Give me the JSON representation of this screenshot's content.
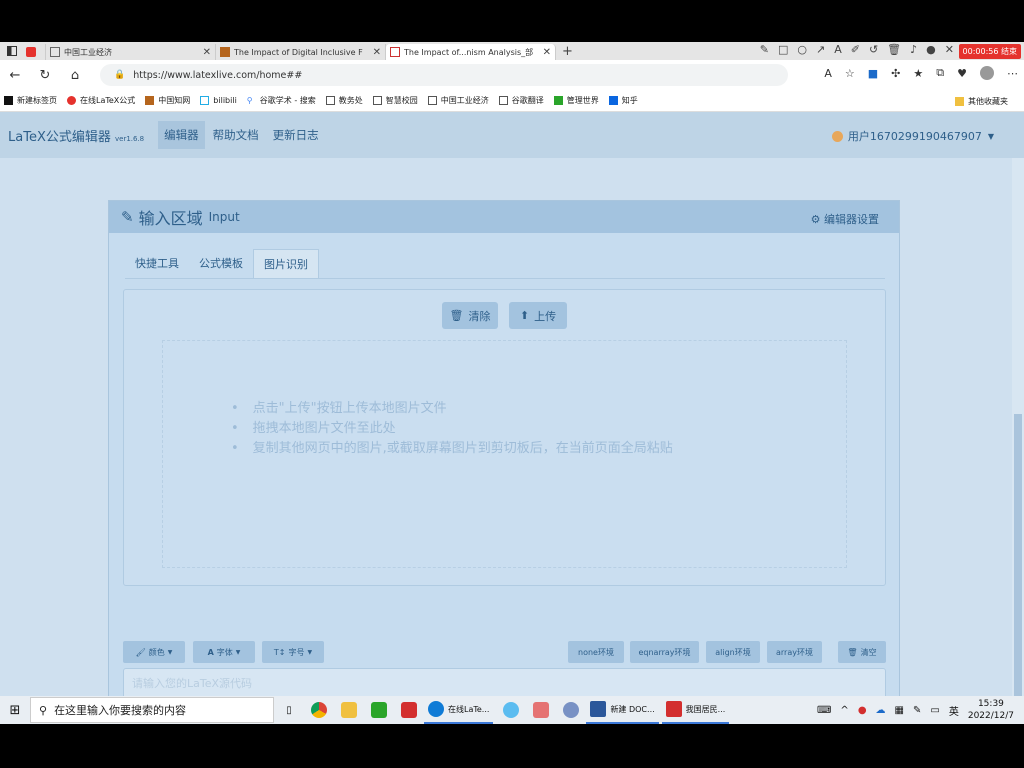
{
  "browser": {
    "tabs": [
      {
        "title": "中国工业经济",
        "active": false
      },
      {
        "title": "The Impact of Digital Inclusive F",
        "active": false
      },
      {
        "title": "The Impact of...nism Analysis_部",
        "active": true
      }
    ],
    "recording_badge": "00:00:56 结束",
    "url": "https://www.latexlive.com/home##",
    "bookmarks": [
      {
        "label": "新建标签页",
        "color": "#111"
      },
      {
        "label": "在线LaTeX公式",
        "color": "#e5322d"
      },
      {
        "label": "中国知网",
        "color": "#b5651d"
      },
      {
        "label": "bilibili",
        "color": "#23ade5"
      },
      {
        "label": "谷歌学术 - 搜索",
        "color": "#4285f4"
      },
      {
        "label": "教务处",
        "color": "#555"
      },
      {
        "label": "智慧校园",
        "color": "#555"
      },
      {
        "label": "中国工业经济",
        "color": "#555"
      },
      {
        "label": "谷歌翻译",
        "color": "#555"
      },
      {
        "label": "管理世界",
        "color": "#2aa52a"
      },
      {
        "label": "知乎",
        "color": "#0a66e0"
      }
    ],
    "other_bookmarks": "其他收藏夹"
  },
  "app": {
    "brand": "LaTeX公式编辑器",
    "version": "ver1.6.8",
    "nav": [
      {
        "label": "编辑器",
        "active": true
      },
      {
        "label": "帮助文档",
        "active": false
      },
      {
        "label": "更新日志",
        "active": false
      }
    ],
    "user": "用户1670299190467907"
  },
  "panel": {
    "title": "输入区域",
    "subtitle": "Input",
    "settings": "编辑器设置",
    "subtabs": [
      {
        "label": "快捷工具",
        "active": false
      },
      {
        "label": "公式模板",
        "active": false
      },
      {
        "label": "图片识别",
        "active": true
      }
    ],
    "clear_label": "清除",
    "upload_label": "上传",
    "hints": [
      "点击\"上传\"按钮上传本地图片文件",
      "拖拽本地图片文件至此处",
      "复制其他网页中的图片,或截取屏幕图片到剪切板后，在当前页面全局粘贴"
    ],
    "toolbar": {
      "color": "颜色",
      "font": "字体",
      "size": "字号",
      "env_none": "none环境",
      "env_eqnarray": "eqnarray环境",
      "env_align": "align环境",
      "env_array": "array环境",
      "clear": "清空"
    },
    "editor_placeholder": "请输入您的LaTeX源代码"
  },
  "taskbar": {
    "search_placeholder": "在这里输入你要搜索的内容",
    "apps": [
      {
        "label": "在线LaTe...",
        "color": "#0f7bd6"
      },
      {
        "label": "新建 DOC...",
        "color": "#2b579a"
      },
      {
        "label": "我国居民...",
        "color": "#d32f2f"
      }
    ],
    "time": "15:39",
    "date": "2022/12/7"
  }
}
